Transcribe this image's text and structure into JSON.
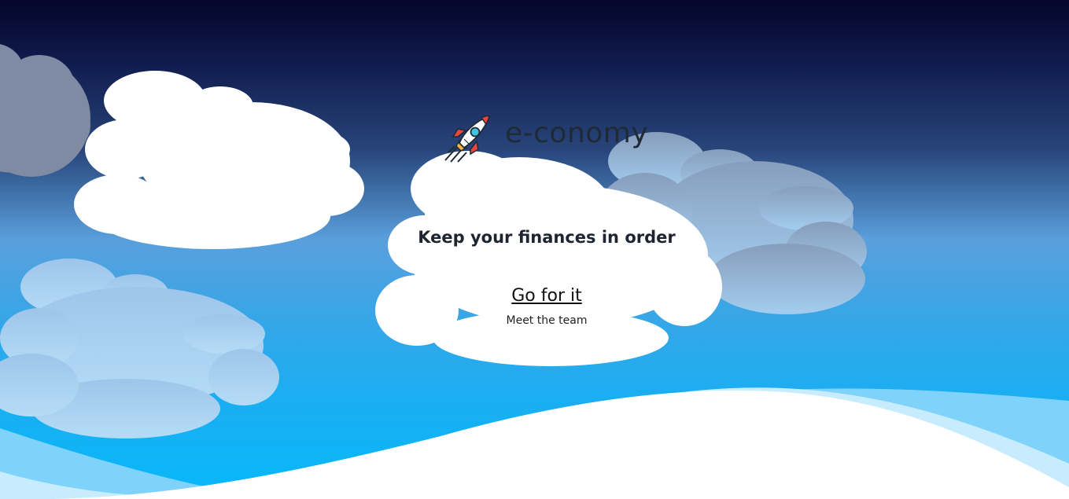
{
  "brand": {
    "name": "e-conomy",
    "logo_icon": "rocket-icon"
  },
  "hero": {
    "tagline": "Keep your finances in order",
    "cta_label": "Go for it",
    "team_link_label": "Meet the team"
  },
  "colors": {
    "sky_top": "#04052a",
    "sky_middle": "#5a9fdc",
    "sky_bottom": "#06b8f8",
    "cloud_white": "#ffffff",
    "cloud_back": "#8fa3c2",
    "text_dark": "#1f2a36"
  }
}
